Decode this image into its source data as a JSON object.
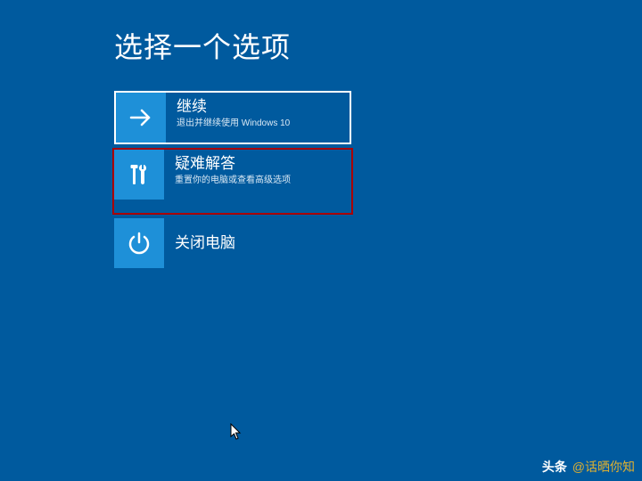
{
  "page": {
    "title": "选择一个选项"
  },
  "options": {
    "continue": {
      "title": "继续",
      "subtitle": "退出并继续使用 Windows 10"
    },
    "troubleshoot": {
      "title": "疑难解答",
      "subtitle": "重置你的电脑或查看高级选项"
    },
    "power": {
      "title": "关闭电脑"
    }
  },
  "watermark": {
    "brand": "头条",
    "handle": "@话晒你知"
  }
}
